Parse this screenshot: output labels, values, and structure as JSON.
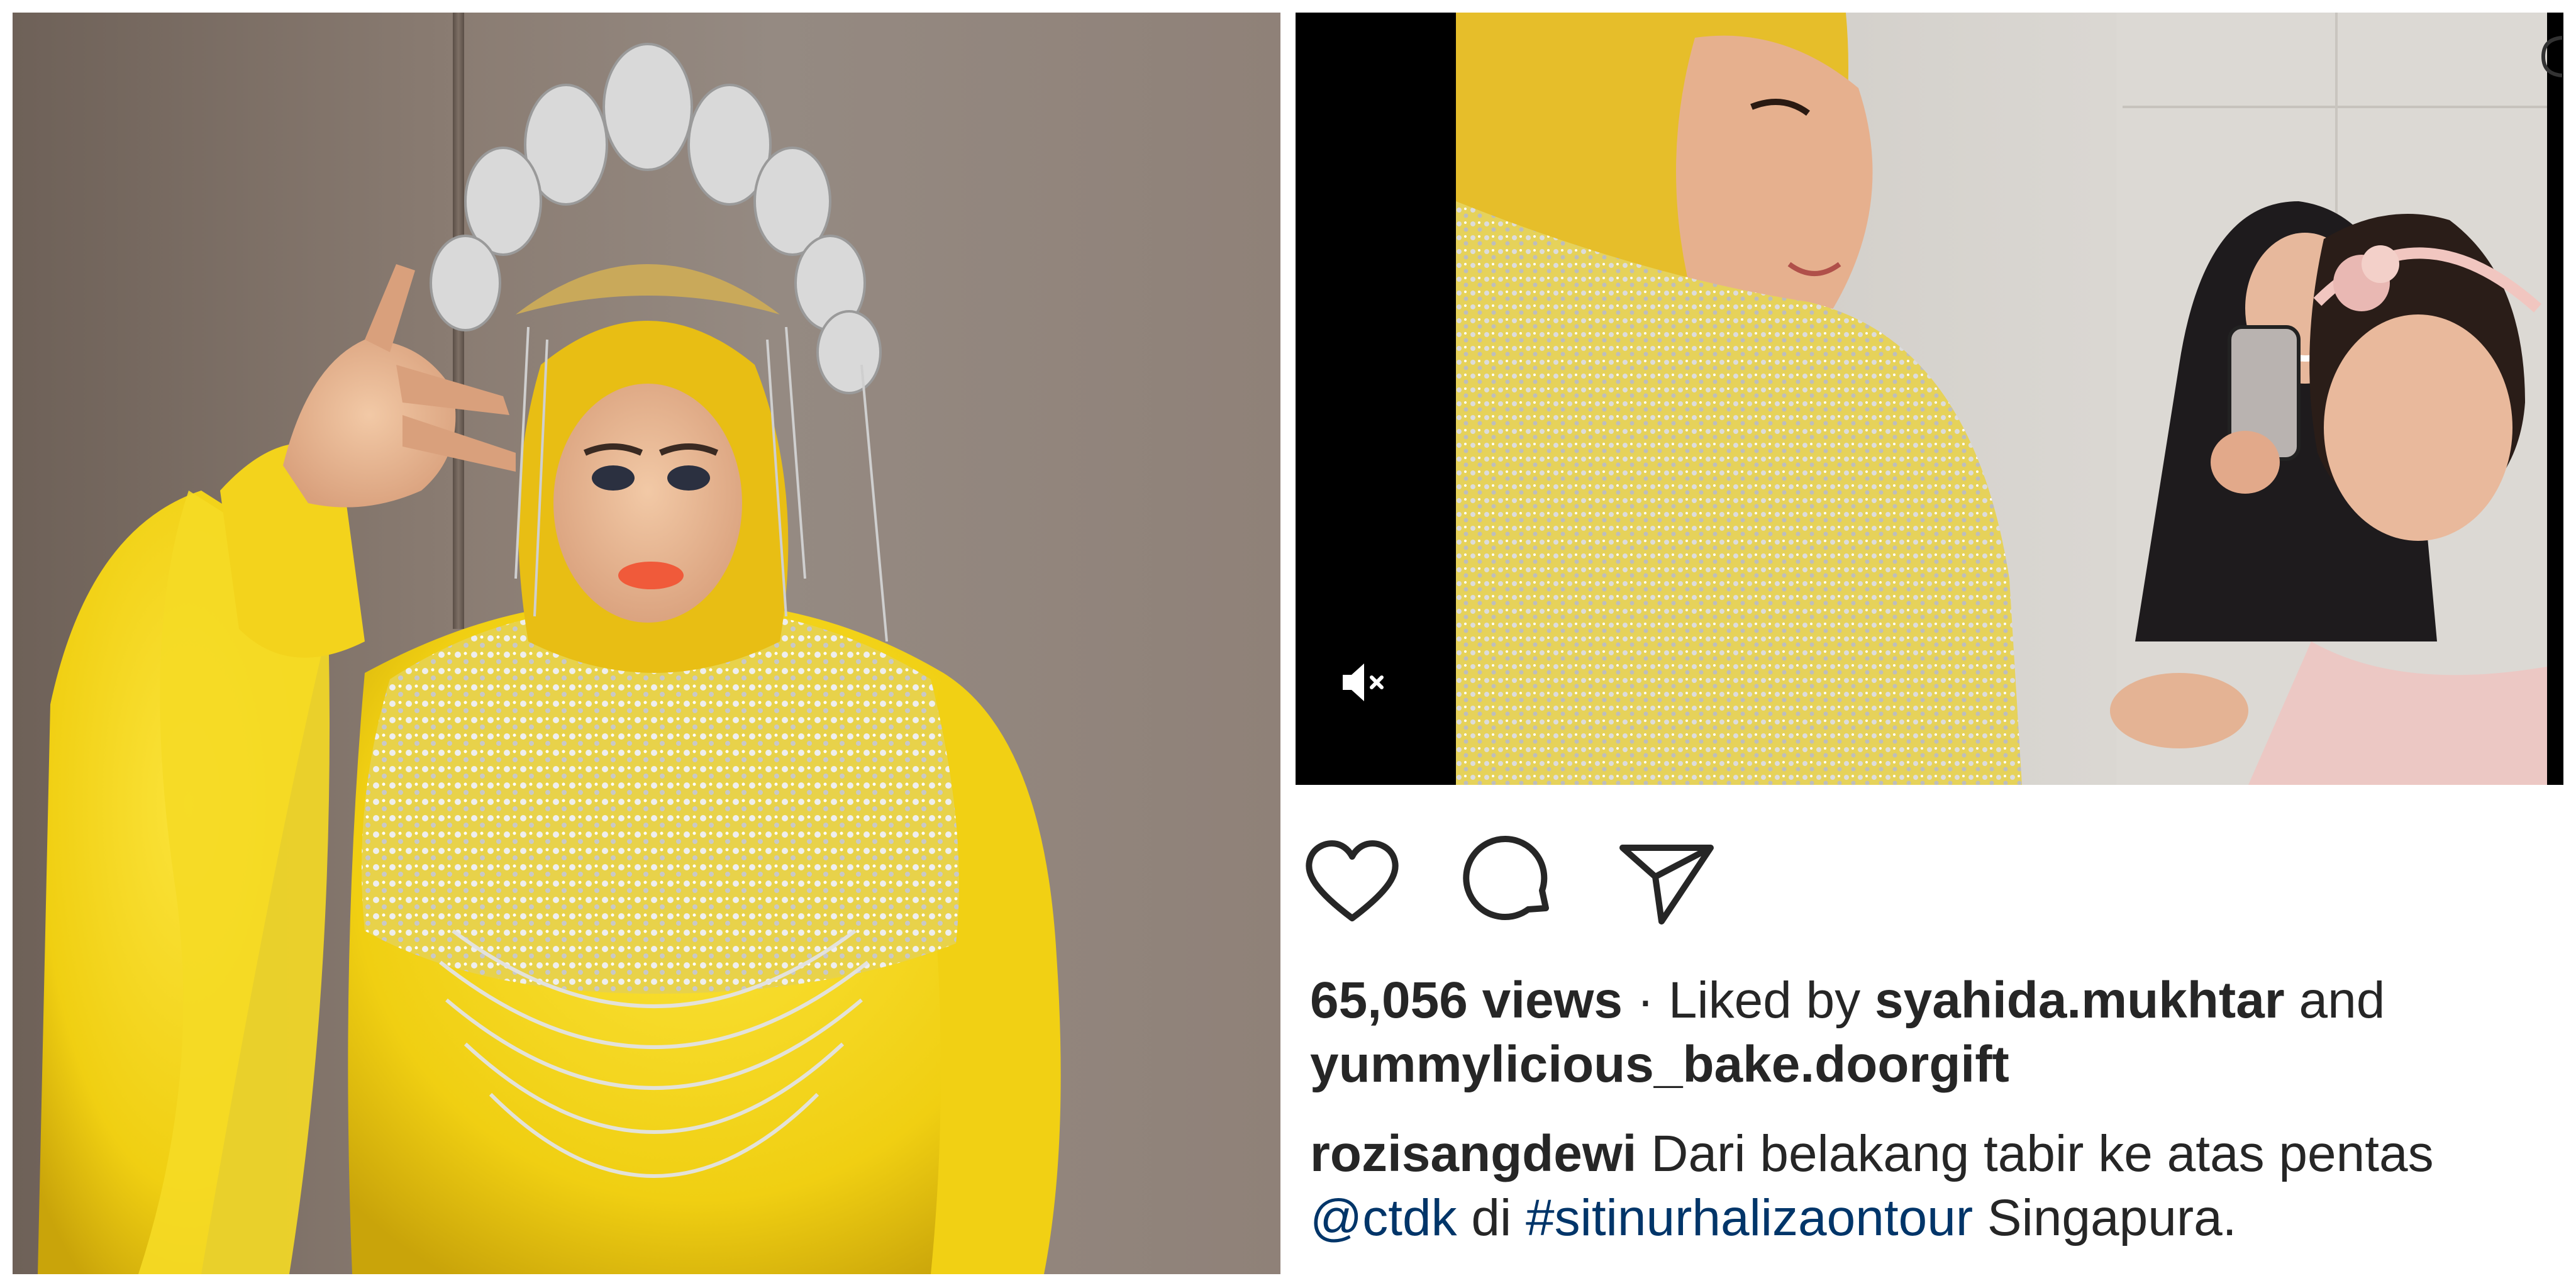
{
  "post": {
    "views_count": "65,056 views",
    "separator": " · ",
    "liked_by_prefix": "Liked by ",
    "liker_one": "syahida.mukhtar",
    "and_word": " and",
    "liker_two": "yummylicious_bake.doorgift",
    "caption": {
      "username": "rozisangdewi",
      "text_part1": " Dari belakang tabir ke atas pentas",
      "mention": "@ctdk",
      "text_part2": " di ",
      "hashtag": "#sitinurhalizaontour",
      "text_part3": " Singapura."
    }
  },
  "video": {
    "muted": true,
    "mute_icon": "speaker-muted-icon"
  },
  "actions": {
    "like_icon": "heart-icon",
    "comment_icon": "comment-bubble-icon",
    "share_icon": "paper-plane-icon"
  },
  "colors": {
    "text": "#262626",
    "link": "#003569",
    "video_bg": "#000000",
    "gown_yellow": "#f2d21b",
    "silver": "#d8d8d8"
  }
}
